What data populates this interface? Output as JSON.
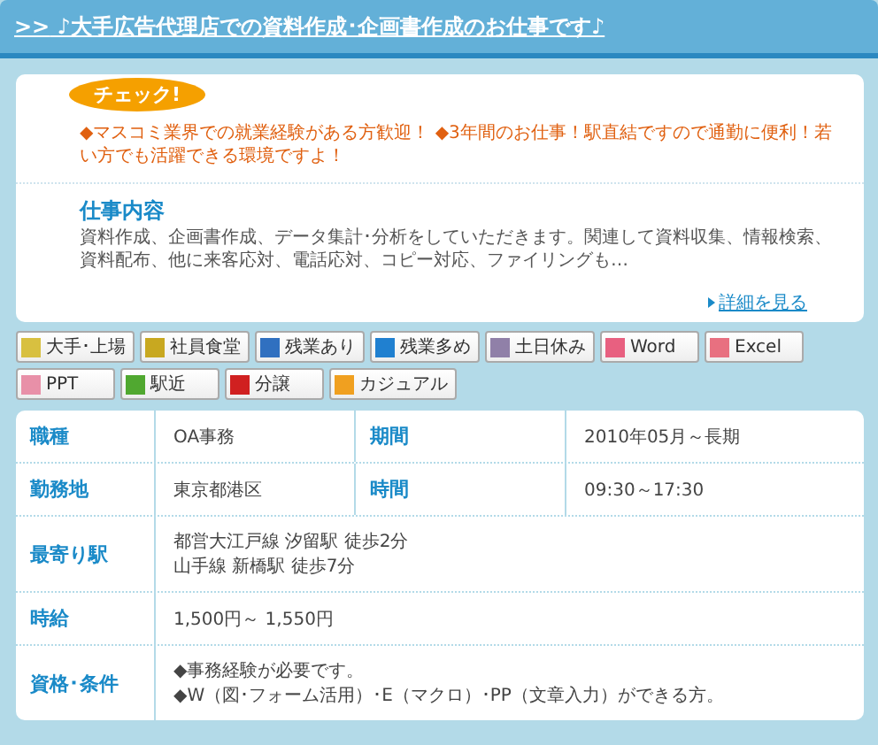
{
  "header": {
    "arrow": ">>",
    "title": "♪大手広告代理店での資料作成･企画書作成のお仕事です♪"
  },
  "check": {
    "badge": "チェック!",
    "text": "◆マスコミ業界での就業経験がある方歓迎！ ◆3年間のお仕事！駅直結ですので通勤に便利！若い方でも活躍できる環境ですよ！"
  },
  "job": {
    "heading": "仕事内容",
    "text": "資料作成、企画書作成、データ集計･分析をしていただきます。関連して資料収集、情報検索、資料配布、他に来客応対、電話応対、コピー対応、ファイリングも…",
    "more": "詳細を見る"
  },
  "tags": [
    {
      "label": "大手･上場",
      "color": "#d8c040"
    },
    {
      "label": "社員食堂",
      "color": "#c8a820"
    },
    {
      "label": "残業あり",
      "color": "#3070c0"
    },
    {
      "label": "残業多め",
      "color": "#2080d0"
    },
    {
      "label": "土日休み",
      "color": "#9080a8"
    },
    {
      "label": "Word",
      "color": "#e86080"
    },
    {
      "label": "Excel",
      "color": "#e87080"
    },
    {
      "label": "PPT",
      "color": "#e890a8"
    },
    {
      "label": "駅近",
      "color": "#50a830"
    },
    {
      "label": "分譲",
      "color": "#d02020"
    },
    {
      "label": "カジュアル",
      "color": "#f0a020"
    }
  ],
  "table": [
    {
      "kind": "pair",
      "cells": [
        {
          "label": "職種",
          "value": [
            "OA事務"
          ]
        },
        {
          "label": "期間",
          "value": [
            "2010年05月～長期"
          ]
        }
      ]
    },
    {
      "kind": "pair",
      "cells": [
        {
          "label": "勤務地",
          "value": [
            "東京都港区"
          ]
        },
        {
          "label": "時間",
          "value": [
            "09:30～17:30"
          ]
        }
      ]
    },
    {
      "kind": "single",
      "cells": [
        {
          "label": "最寄り駅",
          "value": [
            "都営大江戸線 汐留駅 徒歩2分",
            "山手線 新橋駅 徒歩7分"
          ]
        }
      ]
    },
    {
      "kind": "single",
      "cells": [
        {
          "label": "時給",
          "value": [
            "1,500円～ 1,550円"
          ]
        }
      ]
    },
    {
      "kind": "single",
      "cells": [
        {
          "label": "資格･条件",
          "value": [
            "◆事務経験が必要です。",
            "◆W（図･フォーム活用）･E（マクロ）･PP（文章入力）ができる方。"
          ]
        }
      ]
    }
  ]
}
